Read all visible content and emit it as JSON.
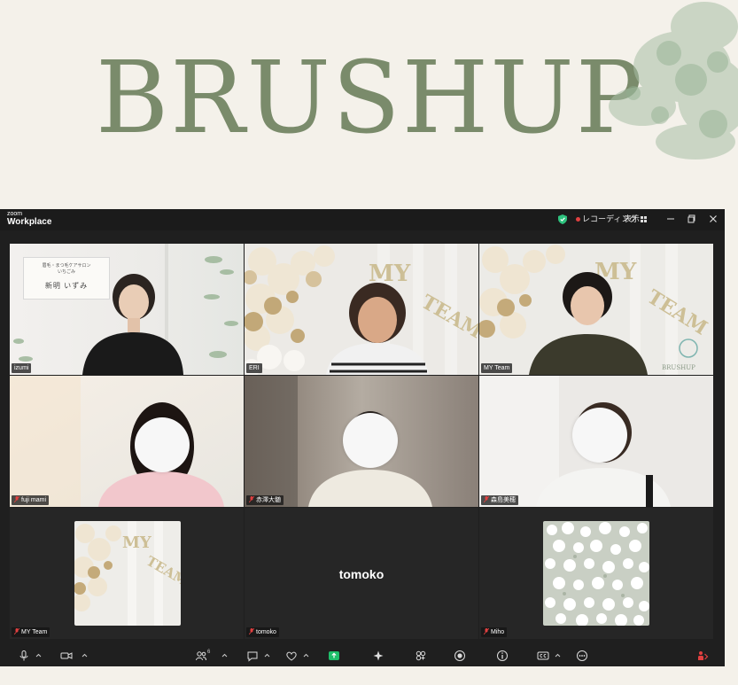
{
  "banner": {
    "title": "BRUSHUP"
  },
  "window": {
    "brand_small": "zoom",
    "brand_main": "Workplace",
    "recording_label": "レコーディング",
    "view_label": "表示"
  },
  "tiles": {
    "izumi": {
      "name": "izumi",
      "sign_line1": "眉毛・まつ毛ケアサロン",
      "sign_line2": "いちごみ",
      "sign_line3": "新明 いずみ"
    },
    "eri": {
      "name": "ERI"
    },
    "myteam_top": {
      "name": "MY Team"
    },
    "fujimami": {
      "name": "fuji mami"
    },
    "akazawa": {
      "name": "赤澤大髄"
    },
    "morishima": {
      "name": "森島美穂"
    },
    "myteam_bottom": {
      "name": "MY Team"
    },
    "tomoko": {
      "name": "tomoko",
      "center_name": "tomoko"
    },
    "miho": {
      "name": "Miho"
    }
  },
  "toolbar": {
    "participants_count": "6"
  },
  "colors": {
    "banner_bg": "#f4f1ea",
    "title_green": "#7a8b6b",
    "window_bg": "#1f1f1f",
    "active_speaker": "#2ec27e",
    "recording_red": "#e04040",
    "share_green": "#1fbf6a"
  }
}
